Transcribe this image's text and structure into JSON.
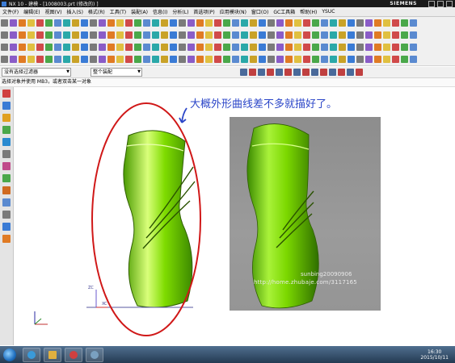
{
  "window": {
    "title": "NX 10 - 建模 - [1008003.prt  (修改的) ]",
    "brand": "SIEMENS"
  },
  "menubar": {
    "items": [
      "文件(F)",
      "编辑(E)",
      "视图(V)",
      "插入(S)",
      "格式(R)",
      "工具(T)",
      "装配(A)",
      "信息(I)",
      "分析(L)",
      "首选项(P)",
      "应用模块(N)",
      "窗口(O)",
      "GC工具箱",
      "帮助(H)",
      "YSUC"
    ]
  },
  "filterbar": {
    "filter_value": "没有选择过滤器",
    "scope_value": "整个装配"
  },
  "prompt": {
    "text": "选择对象并使用 MB3，或者双击某一对象"
  },
  "annotation": {
    "text": "大概外形曲线差不多就描好了。",
    "color": "#2b46c8"
  },
  "watermark": {
    "line1": "sunbing20090906",
    "line2": "http://home.zhubaje.com/3117165"
  },
  "triad": {
    "zc": "ZC",
    "xc": "XC"
  },
  "taskbar": {
    "time": "16:30",
    "date": "2015/10/11"
  },
  "colors": {
    "bottle": "#6fd400",
    "ellipse": "#d01818",
    "taskbar": "#2d4560"
  }
}
